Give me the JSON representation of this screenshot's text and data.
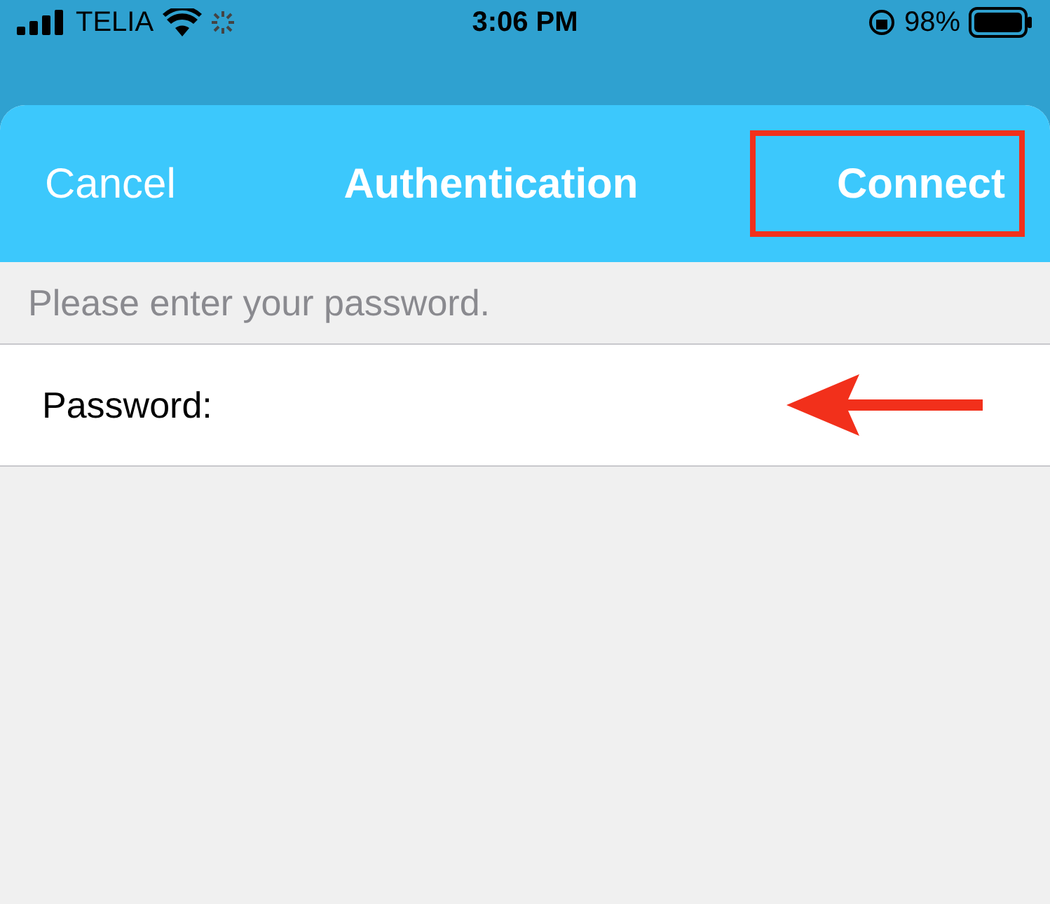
{
  "status_bar": {
    "carrier": "TELIA",
    "time": "3:06 PM",
    "battery": "98%"
  },
  "sheet": {
    "cancel": "Cancel",
    "title": "Authentication",
    "connect": "Connect",
    "connect_highlighted": true
  },
  "caption": "Please enter your password.",
  "fields": [
    {
      "label": "Password:",
      "pointed_at": true
    }
  ]
}
